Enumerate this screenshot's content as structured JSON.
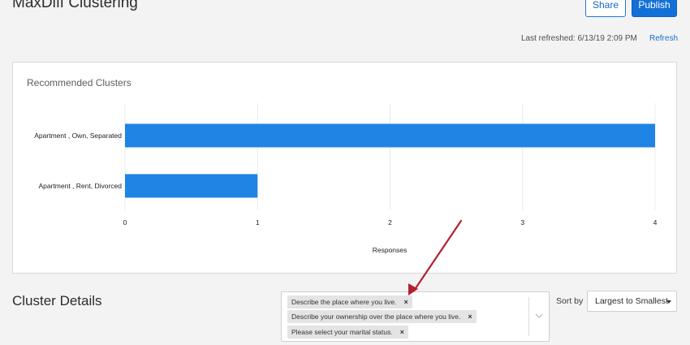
{
  "header": {
    "title": "MaxDiff Clustering",
    "share_label": "Share",
    "publish_label": "Publish"
  },
  "refresh": {
    "last_refreshed": "Last refreshed: 6/13/19 2:09 PM",
    "refresh_label": "Refresh"
  },
  "chart_card": {
    "title": "Recommended Clusters"
  },
  "chart_data": {
    "type": "bar",
    "orientation": "horizontal",
    "categories": [
      "Apartment , Own, Separated",
      "Apartment , Rent, Divorced"
    ],
    "values": [
      4,
      1
    ],
    "xlabel": "Responses",
    "xlim": [
      0,
      4
    ],
    "xticks": [
      "0",
      "1",
      "2",
      "3",
      "4"
    ],
    "grid": true,
    "bar_color": "#1f84e3"
  },
  "cluster_details": {
    "title": "Cluster Details",
    "filters": [
      "Describe the place where you live.",
      "Describe your ownership over the place where you live.",
      "Please select your marital status."
    ],
    "remove_glyph": "×",
    "sort_label": "Sort by",
    "sort_value": "Largest to Smallest"
  },
  "annotation": {
    "arrow_color": "#b3202e"
  }
}
